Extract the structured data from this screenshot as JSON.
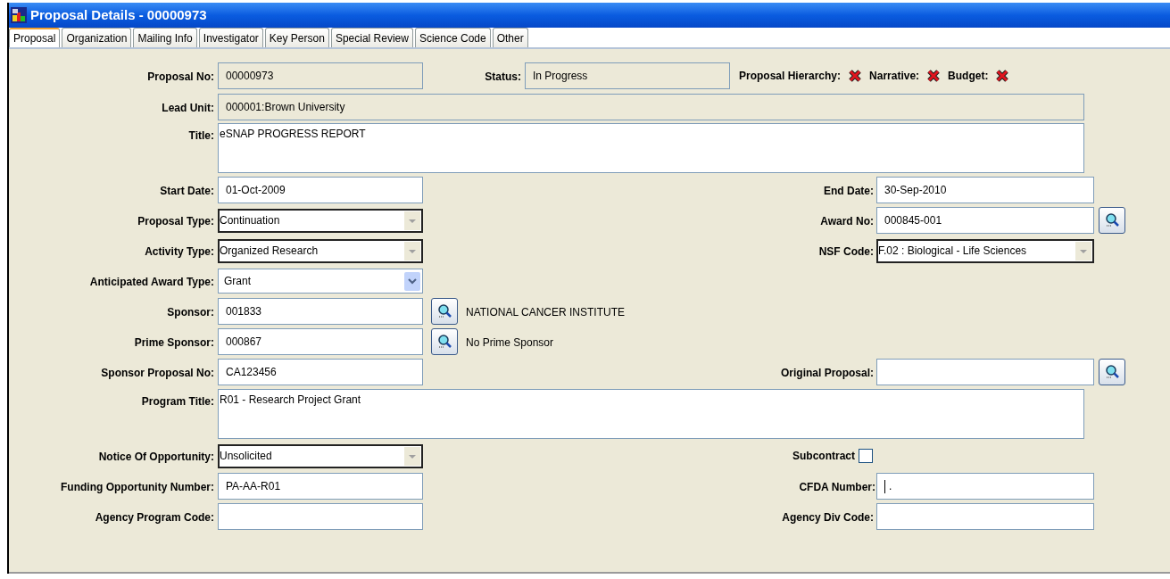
{
  "window": {
    "title": "Proposal Details - 00000973"
  },
  "tabs": [
    {
      "label": "Proposal",
      "selected": true
    },
    {
      "label": "Organization",
      "selected": false
    },
    {
      "label": "Mailing Info",
      "selected": false
    },
    {
      "label": "Investigator",
      "selected": false
    },
    {
      "label": "Key Person",
      "selected": false
    },
    {
      "label": "Special Review",
      "selected": false
    },
    {
      "label": "Science Code",
      "selected": false
    },
    {
      "label": "Other",
      "selected": false
    }
  ],
  "header": {
    "proposal_no": {
      "label": "Proposal No:",
      "value": "00000973",
      "readonly": true
    },
    "status": {
      "label": "Status:",
      "value": "In Progress",
      "readonly": true
    },
    "indicators": [
      {
        "label": "Proposal Hierarchy:",
        "complete": false
      },
      {
        "label": "Narrative:",
        "complete": false
      },
      {
        "label": "Budget:",
        "complete": false
      }
    ]
  },
  "rows": [
    {
      "left": {
        "label": "Lead Unit:",
        "kind": "text",
        "value": "000001:Brown University",
        "readonly": true,
        "wide": true
      }
    },
    {
      "left": {
        "label": "Title:",
        "kind": "textarea",
        "value": "eSNAP PROGRESS REPORT",
        "readonly": false,
        "wide": true
      }
    },
    {
      "left": {
        "label": "Start Date:",
        "kind": "text",
        "value": "01-Oct-2009",
        "readonly": false
      },
      "right": {
        "label": "End Date:",
        "kind": "text",
        "value": "30-Sep-2010",
        "readonly": false
      }
    },
    {
      "left": {
        "label": "Proposal Type:",
        "kind": "combo",
        "value": "Continuation"
      },
      "right": {
        "label": "Award No:",
        "kind": "text",
        "value": "000845-001",
        "readonly": false,
        "lookup": true
      }
    },
    {
      "left": {
        "label": "Activity Type:",
        "kind": "combo",
        "value": "Organized Research"
      },
      "right": {
        "label": "NSF Code:",
        "kind": "combo",
        "value": "F.02 : Biological - Life Sciences"
      }
    },
    {
      "left": {
        "label": "Anticipated Award Type:",
        "kind": "dropdown",
        "value": "Grant"
      }
    },
    {
      "left": {
        "label": "Sponsor:",
        "kind": "text",
        "value": "001833",
        "readonly": false,
        "lookup": true,
        "note": "NATIONAL CANCER INSTITUTE"
      }
    },
    {
      "left": {
        "label": "Prime Sponsor:",
        "kind": "text",
        "value": "000867",
        "readonly": false,
        "lookup": true,
        "note": "No Prime Sponsor"
      }
    },
    {
      "left": {
        "label": "Sponsor Proposal No:",
        "kind": "text",
        "value": "CA123456",
        "readonly": false
      },
      "right": {
        "label": "Original Proposal:",
        "kind": "text",
        "readonly": false,
        "lookup": true
      }
    },
    {
      "left": {
        "label": "Program Title:",
        "kind": "textarea",
        "value": "R01 - Research Project Grant",
        "readonly": false,
        "wide": true
      }
    },
    {
      "left": {
        "label": "Notice Of Opportunity:",
        "kind": "combo",
        "value": "Unsolicited"
      },
      "right": {
        "label": "Subcontract",
        "kind": "checkbox",
        "checked": false
      }
    },
    {
      "left": {
        "label": "Funding Opportunity Number:",
        "kind": "text",
        "value": "PA-AA-R01",
        "readonly": false
      },
      "right": {
        "label": "CFDA Number:",
        "kind": "text",
        "value": ".",
        "readonly": false,
        "focused": true
      }
    },
    {
      "left": {
        "label": "Agency Program Code:",
        "kind": "text",
        "readonly": false
      },
      "right": {
        "label": "Agency Div Code:",
        "kind": "text",
        "readonly": false
      }
    }
  ]
}
